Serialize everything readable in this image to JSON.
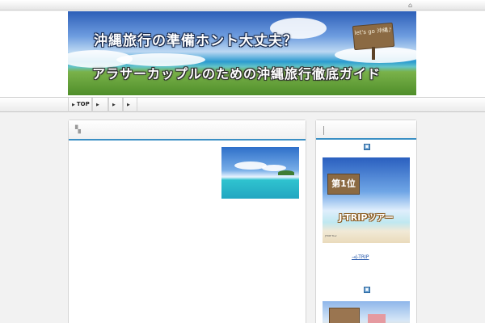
{
  "header": {
    "title": "沖縄旅行の準備ホント大丈夫？",
    "subtitle": "アラサーカップルのための沖縄旅行徹底ガイド",
    "sign_text": "let's go 沖縄♪"
  },
  "nav": {
    "items": [
      "TOP",
      "",
      "",
      ""
    ]
  },
  "sidebar": {
    "rank1": {
      "rank_label": "第1位",
      "banner_title": "J-TRIPツアー",
      "caption": "JTRIP Tour",
      "link_text": "→J-TRIP"
    }
  },
  "colors": {
    "accent": "#3a8fc4",
    "link": "#2255aa",
    "background": "#f2f2f2"
  }
}
